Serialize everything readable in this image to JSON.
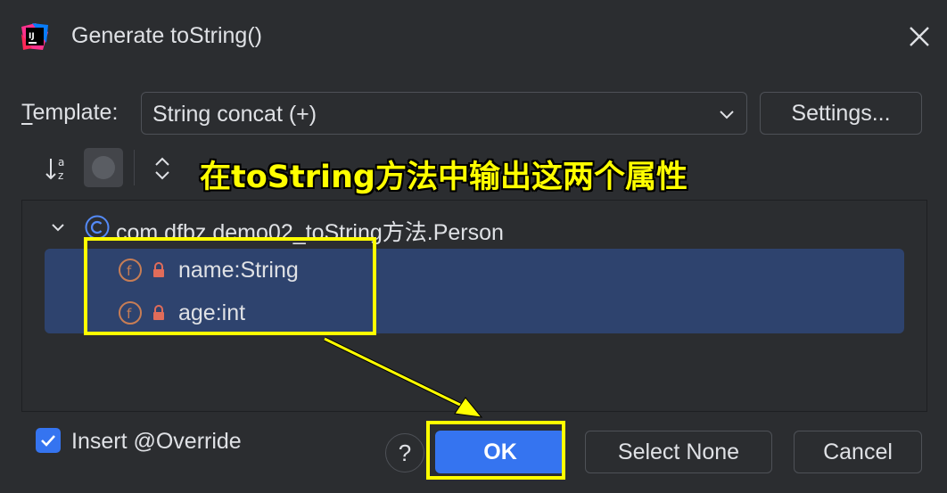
{
  "dialog": {
    "title": "Generate toString()",
    "app_icon_text": "IJ"
  },
  "template": {
    "label_mnemonic": "T",
    "label_rest": "emplate:",
    "selected": "String concat (+)",
    "settings_label": "Settings..."
  },
  "annotation": {
    "text": "在toString方法中输出这两个属性",
    "color": "#ffff00"
  },
  "tree": {
    "class_name": "com.dfbz.demo02_toString方法.Person",
    "fields": [
      {
        "label": "name:String"
      },
      {
        "label": "age:int"
      }
    ]
  },
  "footer": {
    "override_label": "Insert @Override",
    "override_checked": true,
    "help_label": "?",
    "ok_label": "OK",
    "select_none_label": "Select None",
    "cancel_label": "Cancel"
  },
  "colors": {
    "background": "#2b2d30",
    "accent": "#3574f0",
    "selection": "#2e436e",
    "highlight": "#ffff00"
  }
}
